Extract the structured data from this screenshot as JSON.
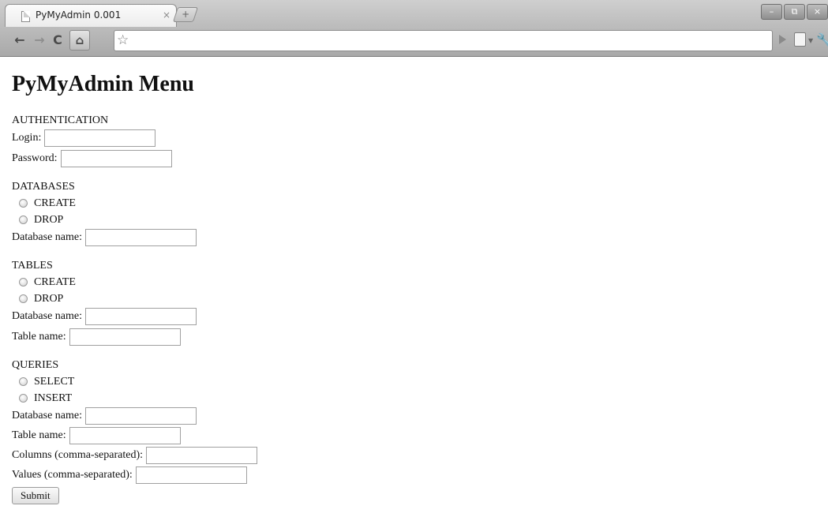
{
  "browser": {
    "tab_title": "PyMyAdmin 0.001",
    "tab_close_glyph": "×",
    "new_tab_glyph": "+",
    "window_buttons": [
      "–",
      "⧉",
      "×"
    ],
    "url": ""
  },
  "page": {
    "heading": "PyMyAdmin Menu",
    "authentication": {
      "title": "AUTHENTICATION",
      "login_label": "Login:",
      "password_label": "Password:"
    },
    "databases": {
      "title": "DATABASES",
      "option_create": "CREATE",
      "option_drop": "DROP",
      "db_name_label": "Database name:"
    },
    "tables": {
      "title": "TABLES",
      "option_create": "CREATE",
      "option_drop": "DROP",
      "db_name_label": "Database name:",
      "table_name_label": "Table name:"
    },
    "queries": {
      "title": "QUERIES",
      "option_select": "SELECT",
      "option_insert": "INSERT",
      "db_name_label": "Database name:",
      "table_name_label": "Table name:",
      "columns_label": "Columns (comma-separated):",
      "values_label": "Values (comma-separated):"
    },
    "submit_label": "Submit"
  }
}
